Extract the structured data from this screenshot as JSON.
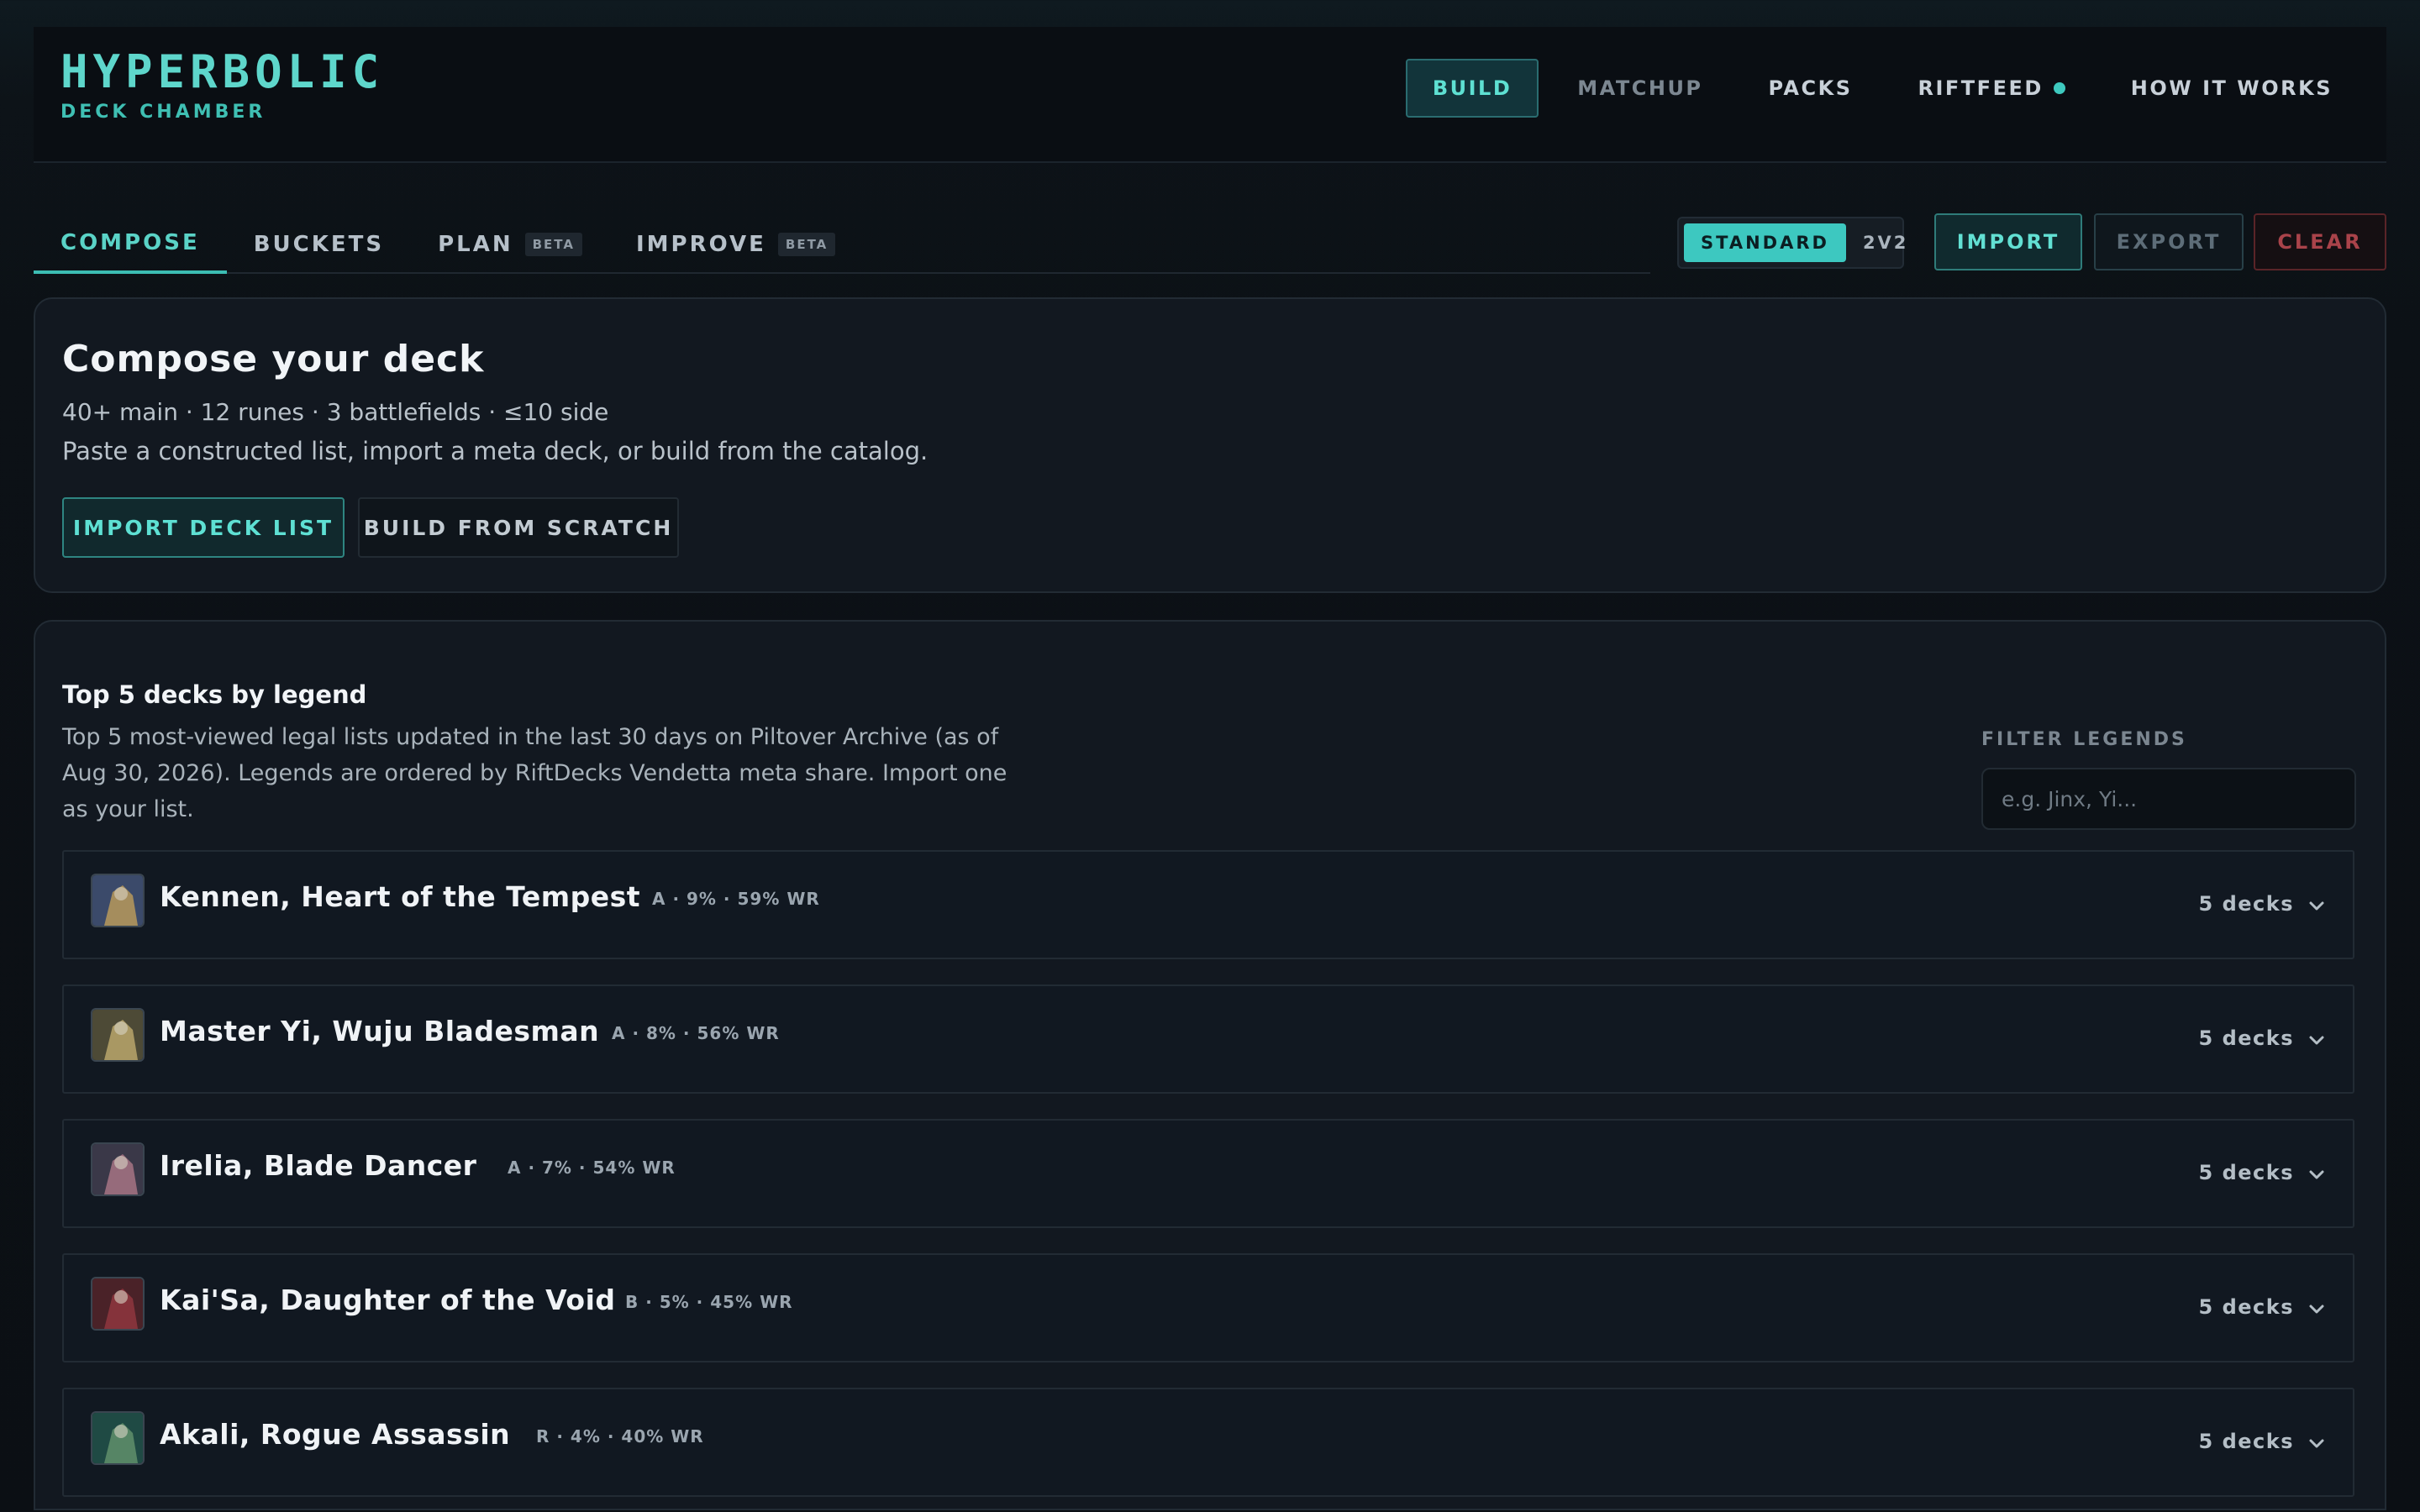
{
  "brand": {
    "title": "HYPERBOLIC",
    "subtitle": "DECK CHAMBER"
  },
  "topnav": [
    "BUILD",
    "MATCHUP",
    "PACKS",
    "RIFTFEED",
    "HOW IT WORKS"
  ],
  "tabs": [
    {
      "label": "COMPOSE",
      "badge": ""
    },
    {
      "label": "BUCKETS",
      "badge": ""
    },
    {
      "label": "PLAN",
      "badge": "BETA"
    },
    {
      "label": "IMPROVE",
      "badge": "BETA"
    }
  ],
  "mode": {
    "standard": "STANDARD",
    "twovtwo": "2V2"
  },
  "actions": {
    "import": "IMPORT",
    "export": "EXPORT",
    "clear": "CLEAR"
  },
  "compose": {
    "title": "Compose your deck",
    "meta": "40+ main · 12 runes · 3 battlefields · ≤10 side",
    "description": "Paste a constructed list, import a meta deck, or build from the catalog.",
    "import_btn": "IMPORT DECK LIST",
    "scratch_btn": "BUILD FROM SCRATCH"
  },
  "top_decks": {
    "title": "Top 5 decks by legend",
    "intro": "Top 5 most-viewed legal lists updated in the last 30 days on Piltover Archive (as of Aug 30, 2026). Legends are ordered by RiftDecks Vendetta meta share. Import one as your list.",
    "filter_label": "FILTER LEGENDS",
    "filter_placeholder": "e.g. Jinx, Yi...",
    "legends": [
      {
        "name": "Kennen, Heart of the Tempest",
        "stats": "A · 9% · 59% WR",
        "decks": "5 decks",
        "colors": [
          "#3b4a6a",
          "#c9a45a"
        ]
      },
      {
        "name": "Master Yi, Wuju Bladesman",
        "stats": "A · 8% · 56% WR",
        "decks": "5 decks",
        "colors": [
          "#4d4a36",
          "#c8b373"
        ]
      },
      {
        "name": "Irelia, Blade Dancer",
        "stats": "A · 7% · 54% WR",
        "decks": "5 decks",
        "colors": [
          "#3a3848",
          "#b57c8c"
        ]
      },
      {
        "name": "Kai'Sa, Daughter of the Void",
        "stats": "B · 5% · 45% WR",
        "decks": "5 decks",
        "colors": [
          "#4a2228",
          "#9a3a42"
        ]
      },
      {
        "name": "Akali, Rogue Assassin",
        "stats": "R · 4% · 40% WR",
        "decks": "5 decks",
        "colors": [
          "#1f4a44",
          "#6a9a70"
        ]
      }
    ]
  }
}
